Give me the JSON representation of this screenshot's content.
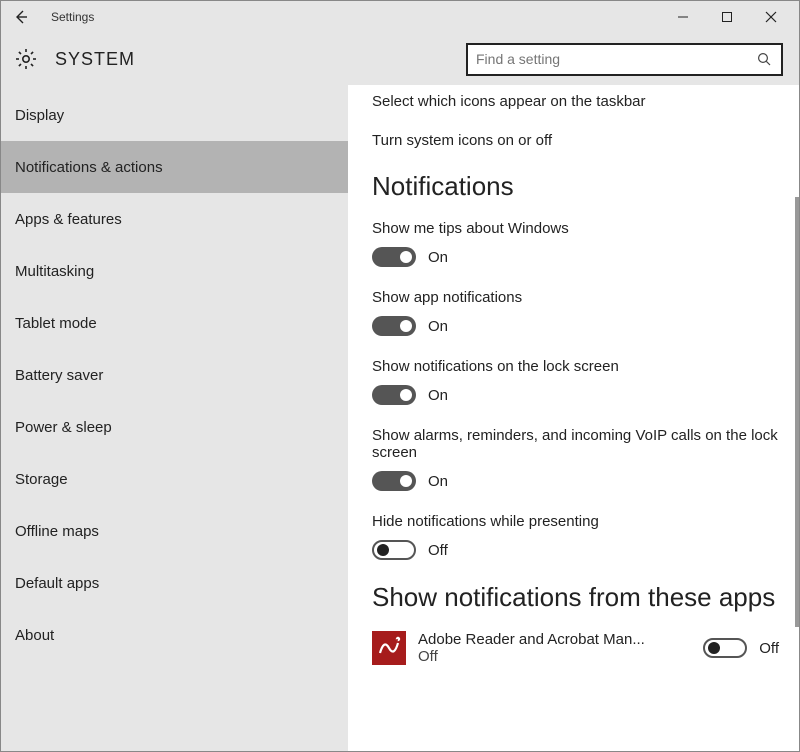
{
  "titlebar": {
    "title": "Settings"
  },
  "header": {
    "system_title": "SYSTEM",
    "search_placeholder": "Find a setting"
  },
  "sidebar": {
    "items": [
      {
        "label": "Display"
      },
      {
        "label": "Notifications & actions"
      },
      {
        "label": "Apps & features"
      },
      {
        "label": "Multitasking"
      },
      {
        "label": "Tablet mode"
      },
      {
        "label": "Battery saver"
      },
      {
        "label": "Power & sleep"
      },
      {
        "label": "Storage"
      },
      {
        "label": "Offline maps"
      },
      {
        "label": "Default apps"
      },
      {
        "label": "About"
      }
    ]
  },
  "content": {
    "link_icons": "Select which icons appear on the taskbar",
    "link_system_icons": "Turn system icons on or off",
    "section_notifications": "Notifications",
    "settings": [
      {
        "label": "Show me tips about Windows",
        "state": "On",
        "on": true
      },
      {
        "label": "Show app notifications",
        "state": "On",
        "on": true
      },
      {
        "label": "Show notifications on the lock screen",
        "state": "On",
        "on": true
      },
      {
        "label": "Show alarms, reminders, and incoming VoIP calls on the lock screen",
        "state": "On",
        "on": true
      },
      {
        "label": "Hide notifications while presenting",
        "state": "Off",
        "on": false
      }
    ],
    "section_apps": "Show notifications from these apps",
    "apps": [
      {
        "name": "Adobe Reader and Acrobat Man...",
        "state_line": "Off",
        "toggle_state": "Off",
        "on": false
      }
    ]
  }
}
